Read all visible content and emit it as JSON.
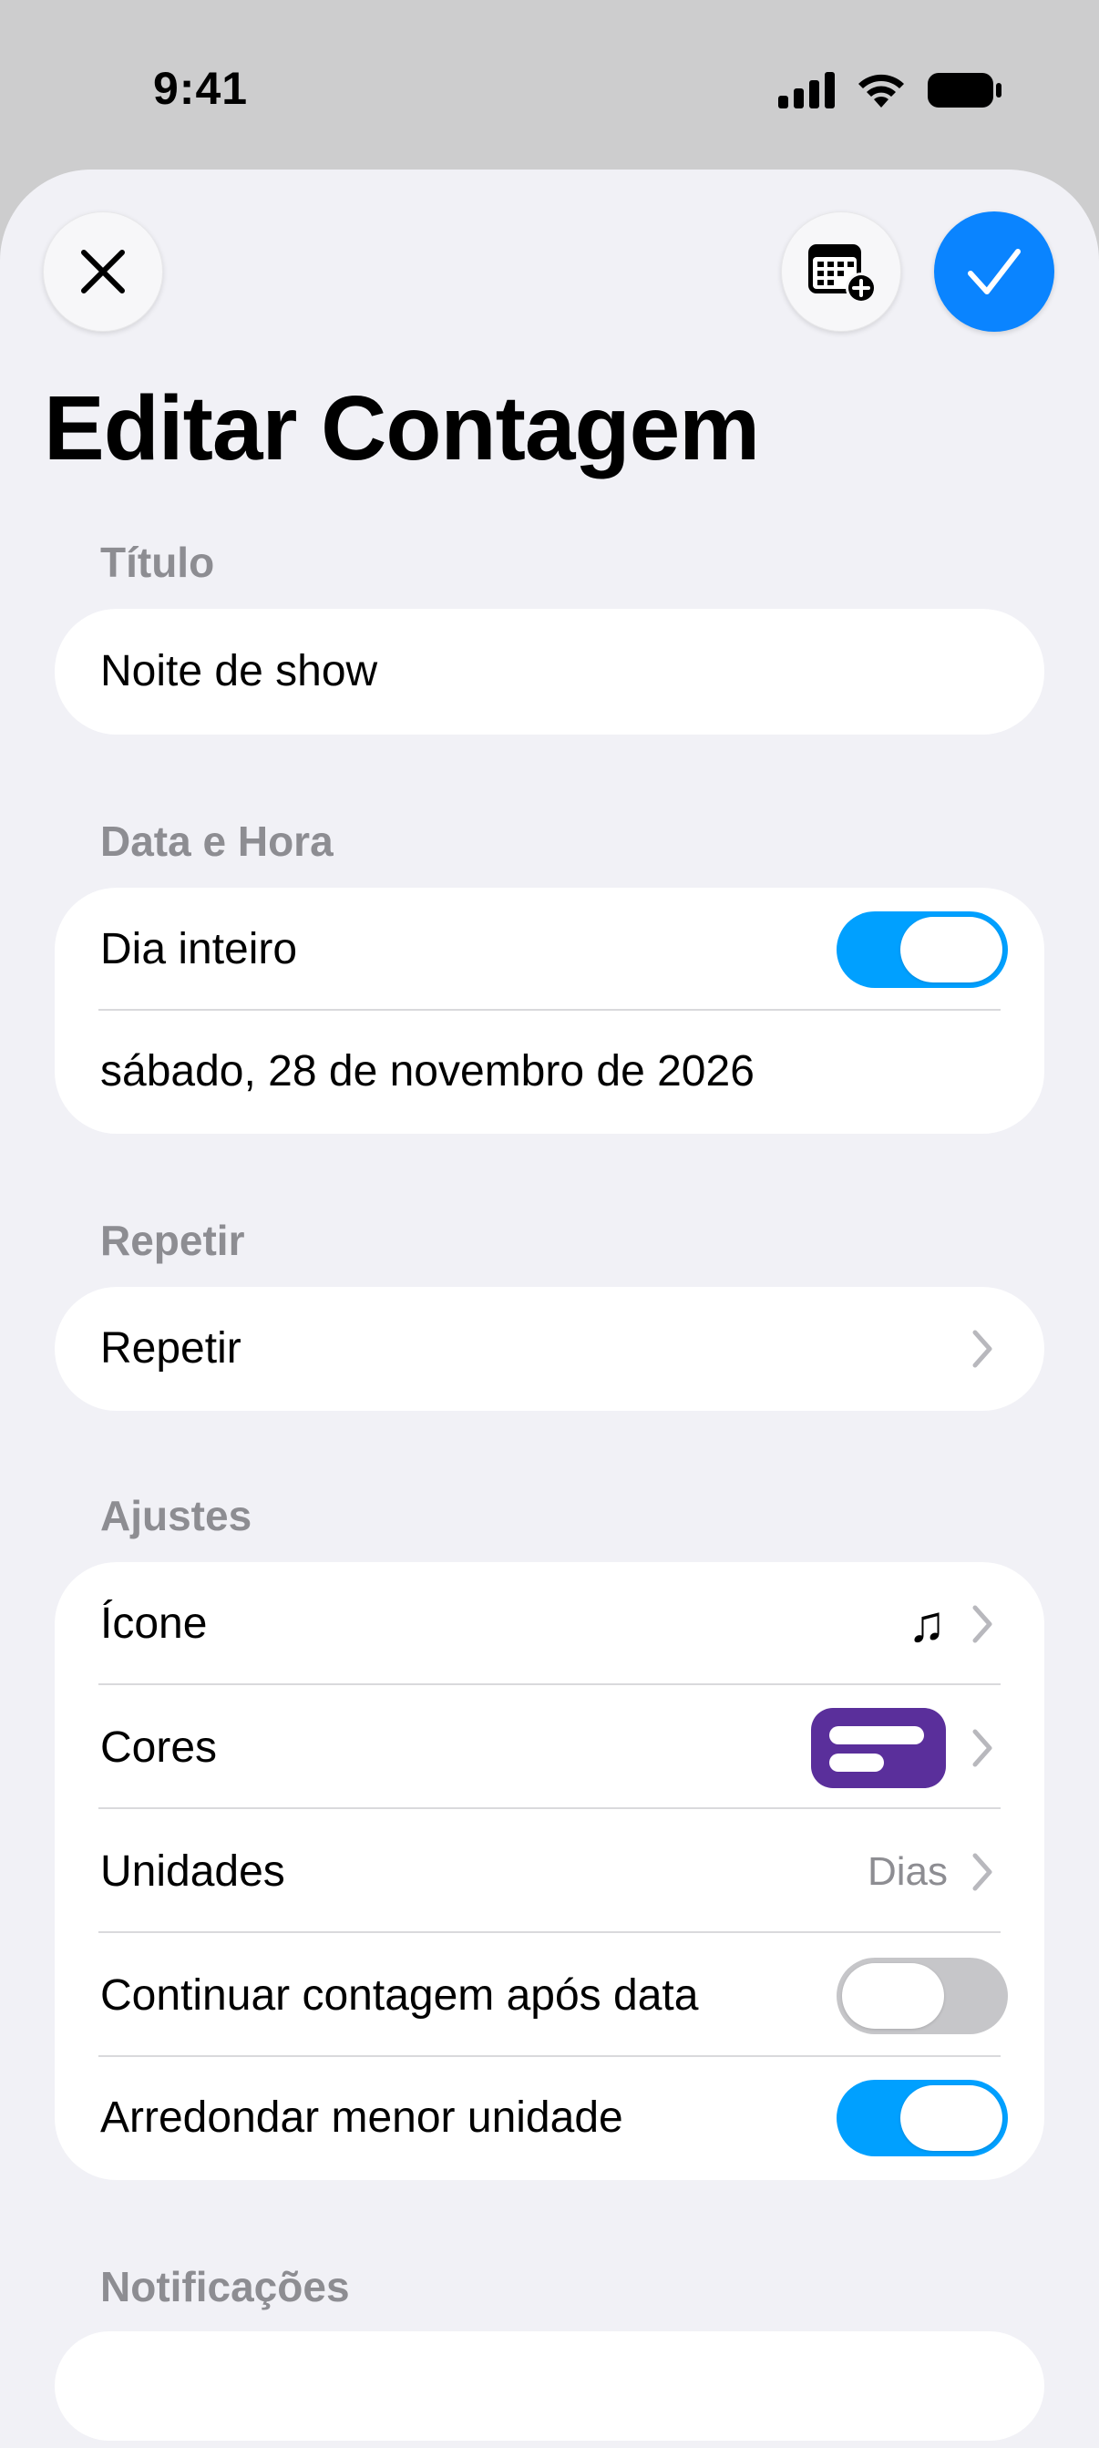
{
  "status": {
    "time": "9:41"
  },
  "header": {
    "title": "Editar Contagem"
  },
  "sections": {
    "title_label": "Título",
    "title_value": "Noite de show",
    "datetime_label": "Data e Hora",
    "all_day_label": "Dia inteiro",
    "all_day_on": true,
    "date_value": "sábado, 28 de novembro de 2026",
    "repeat_label": "Repetir",
    "repeat_row": "Repetir",
    "settings_label": "Ajustes",
    "icon_label": "Ícone",
    "icon_value": "♫",
    "colors_label": "Cores",
    "color_swatch": "#5a2f9b",
    "units_label": "Unidades",
    "units_value": "Dias",
    "continue_label": "Continuar contagem após data",
    "continue_on": false,
    "round_label": "Arredondar menor unidade",
    "round_on": true,
    "notifications_label": "Notificações"
  },
  "colors": {
    "accent": "#0a84ff",
    "toggle_on": "#00a0ff",
    "toggle_off": "#c6c6c9",
    "background": "#f1f1f6"
  }
}
